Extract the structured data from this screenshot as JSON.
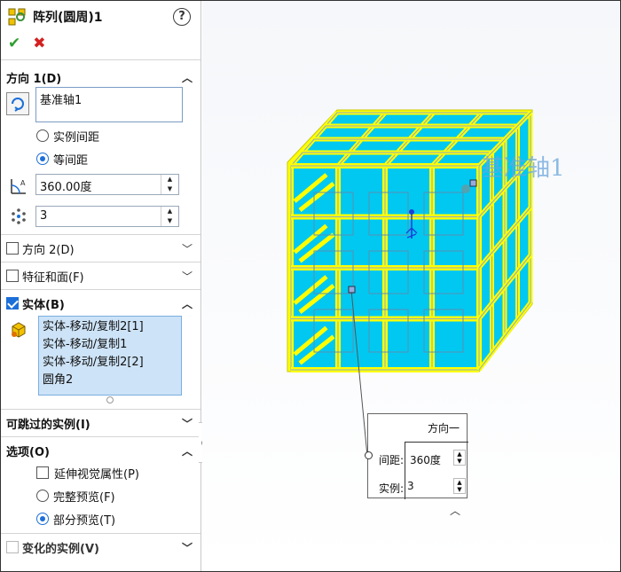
{
  "window": {
    "title": "阵列(圆周)1"
  },
  "actions": {
    "ok": "✔",
    "cancel": "✖"
  },
  "direction1": {
    "header": "方向 1(D)",
    "axis_value": "基准轴1",
    "radio_instance_spacing": "实例间距",
    "radio_equal_spacing": "等间距",
    "angle_value": "360.00度",
    "count_value": "3"
  },
  "sections": {
    "direction2": "方向 2(D)",
    "features_faces": "特征和面(F)",
    "bodies": "实体(B)",
    "skip_instances": "可跳过的实例(I)",
    "options": "选项(O)",
    "varied_instances": "变化的实例(V)"
  },
  "bodies_list": [
    "实体-移动/复制2[1]",
    "实体-移动/复制1",
    "实体-移动/复制2[2]",
    "圆角2"
  ],
  "options": {
    "extend_visual": "延伸视觉属性(P)",
    "full_preview": "完整预览(F)",
    "partial_preview": "部分预览(T)"
  },
  "viewport": {
    "axis_label": "基准轴1",
    "callout_title": "方向一",
    "spacing_label": "间距:",
    "spacing_value": "360度",
    "instances_label": "实例:",
    "instances_value": "3"
  },
  "colors": {
    "accent": "#1c6fd8",
    "body_yellow": "#ffff00",
    "body_cyan": "#00c8f0"
  }
}
